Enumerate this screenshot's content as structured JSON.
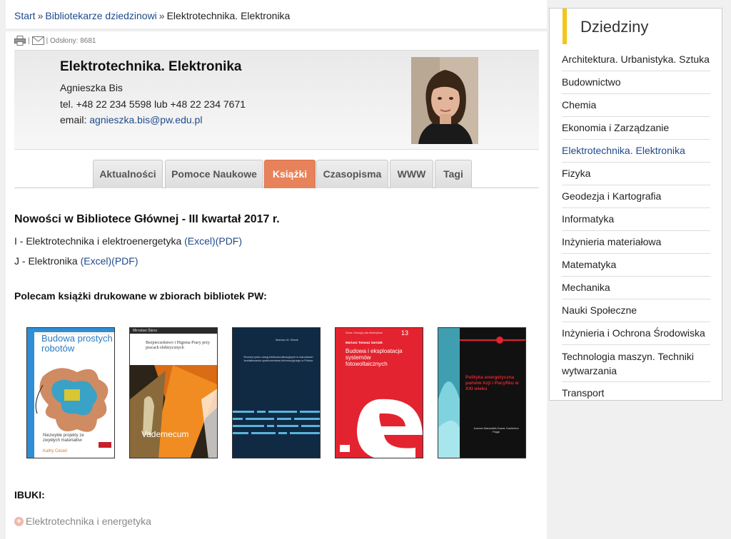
{
  "breadcrumb": {
    "home": "Start",
    "sep1": "»",
    "parent": "Bibliotekarze dziedzinowi",
    "sep2": "»",
    "current": "Elektrotechnika. Elektronika"
  },
  "tools": {
    "print_icon": "printer-icon",
    "mail_icon": "envelope-icon",
    "divider": "|",
    "views_label": "| Odsłony: 8681"
  },
  "profile": {
    "title": "Elektrotechnika. Elektronika",
    "name": "Agnieszka Bis",
    "phone": "tel. +48 22 234 5598 lub +48 22 234 7671",
    "email_label": "email:",
    "email": "agnieszka.bis@pw.edu.pl"
  },
  "tabs": [
    {
      "label": "Aktualności"
    },
    {
      "label": "Pomoce Naukowe"
    },
    {
      "label": "Książki"
    },
    {
      "label": "Czasopisma"
    },
    {
      "label": "WWW"
    },
    {
      "label": "Tagi"
    }
  ],
  "content": {
    "section_title": "Nowości w Bibliotece Głównej - III kwartał 2017 r.",
    "line1_text": "I - Elektrotechnika i elektroenergetyka",
    "line2_text": "J - Elektronika",
    "excel": "(Excel)",
    "pdf": "(PDF)",
    "recommend": "Polecam książki drukowane w zbiorach bibliotek PW:",
    "ibuki_label": "IBUKI:",
    "ebook_link": "Elektrotechnika i energetyka"
  },
  "books": [
    {
      "title": "Budowa prostych robotów",
      "subtitle": "Niezwykłe projekty ze zwykłych materiałów",
      "author": "Kathy Ceceri"
    },
    {
      "title": "Bezpieczeństwo i Higiena Pracy przy pracach elektrycznych",
      "author": "Mirosław Ślęna",
      "series": "Vademecum"
    },
    {
      "title": "Rozwój rynku usług telekomunikacyjnych w warunkach kształtowania społeczeństwa informacyjnego w Polsce",
      "author": "Mariusz M. Stanik"
    },
    {
      "title": "Budowa i eksploatacja systemów fotowoltaicznych",
      "author": "Mariusz Tomasz Sarniak",
      "series": "Seria: Zeszyty dla elektryków",
      "number": "13"
    },
    {
      "title": "Polityka energetyczna państw Azji i Pacyfiku w XXI wieku",
      "author": "Joanna Marszałek-Kawa, Kazimierz Pająk"
    }
  ],
  "sidebar": {
    "title": "Dziedziny",
    "items": [
      {
        "label": "Architektura. Urbanistyka. Sztuka"
      },
      {
        "label": "Budownictwo"
      },
      {
        "label": "Chemia"
      },
      {
        "label": "Ekonomia i Zarządzanie"
      },
      {
        "label": "Elektrotechnika. Elektronika"
      },
      {
        "label": "Fizyka"
      },
      {
        "label": "Geodezja i Kartografia"
      },
      {
        "label": "Informatyka"
      },
      {
        "label": "Inżynieria materiałowa"
      },
      {
        "label": "Matematyka"
      },
      {
        "label": "Mechanika"
      },
      {
        "label": "Nauki Społeczne"
      },
      {
        "label": "Inżynieria i Ochrona Środowiska"
      },
      {
        "label": "Technologia maszyn. Techniki wytwarzania"
      },
      {
        "label": "Transport"
      }
    ]
  },
  "colors": {
    "link": "#1e4a8a",
    "active_tab": "#e8825a",
    "sidebar_accent": "#f5c518"
  }
}
